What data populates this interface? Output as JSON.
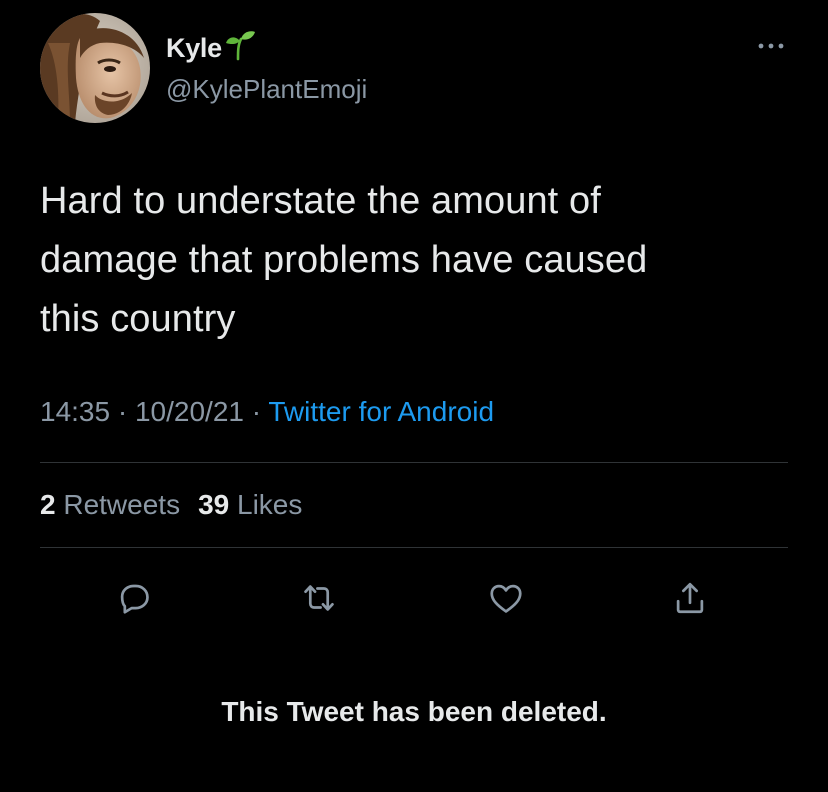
{
  "author": {
    "display_name": "Kyle",
    "handle": "@KylePlantEmoji",
    "name_emoji": "sprout-icon"
  },
  "tweet": {
    "text_lines": [
      "Hard to understate the amount of",
      "damage that problems have caused",
      "this country"
    ],
    "time": "14:35",
    "date": "10/20/21",
    "separator": "·",
    "source": "Twitter for Android"
  },
  "stats": {
    "retweets_count": "2",
    "retweets_label": "Retweets",
    "likes_count": "39",
    "likes_label": "Likes"
  },
  "actions": [
    {
      "name": "reply",
      "icon": "reply-icon"
    },
    {
      "name": "retweet",
      "icon": "retweet-icon"
    },
    {
      "name": "like",
      "icon": "heart-icon"
    },
    {
      "name": "share",
      "icon": "share-icon"
    }
  ],
  "footer": {
    "message": "This Tweet has been deleted."
  },
  "colors": {
    "background": "#000000",
    "primary_text": "#e7e9ea",
    "secondary_text": "#8b98a5",
    "link": "#1d9bf0",
    "divider": "#2f3336",
    "sprout_green": "#5fb53a"
  }
}
